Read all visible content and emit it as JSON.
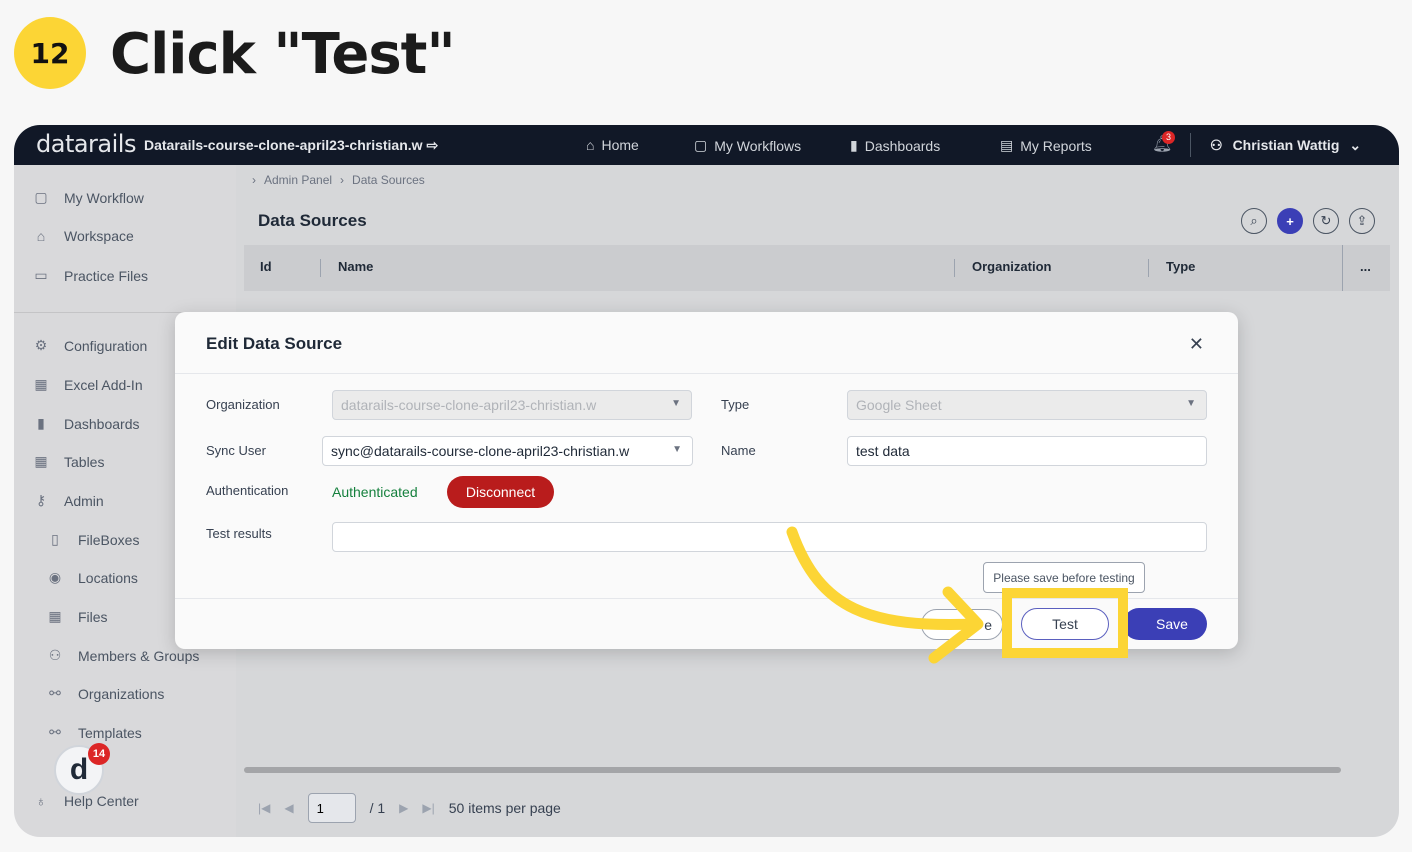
{
  "step": {
    "number": "12",
    "title": "Click \"Test\""
  },
  "topbar": {
    "logo": "datarails",
    "org": "Datarails-course-clone-april23-christian.w",
    "nav": [
      {
        "label": "Home",
        "icon": "home-icon"
      },
      {
        "label": "My Workflows",
        "icon": "clipboard-icon"
      },
      {
        "label": "Dashboards",
        "icon": "bar-chart-icon"
      },
      {
        "label": "My Reports",
        "icon": "document-icon"
      }
    ],
    "notifications": "3",
    "user": "Christian Wattig"
  },
  "sidebar": {
    "top_items": [
      "My Workflow",
      "Workspace",
      "Practice Files"
    ],
    "items": [
      "Configuration",
      "Excel Add-In",
      "Dashboards",
      "Tables",
      "Admin"
    ],
    "admin_items": [
      "FileBoxes",
      "Locations",
      "Files",
      "Members & Groups",
      "Organizations",
      "Templates"
    ],
    "help": "Help Center",
    "helper_badge": "14"
  },
  "main": {
    "breadcrumb": [
      "Admin Panel",
      "Data Sources"
    ],
    "title": "Data Sources",
    "columns": [
      "Id",
      "Name",
      "Organization",
      "Type",
      "..."
    ],
    "pager": {
      "page": "1",
      "total": "/ 1",
      "per_page": "50 items per page"
    }
  },
  "modal": {
    "title": "Edit Data Source",
    "labels": {
      "organization": "Organization",
      "type": "Type",
      "sync_user": "Sync User",
      "name": "Name",
      "authentication": "Authentication",
      "test_results": "Test results"
    },
    "values": {
      "organization": "datarails-course-clone-april23-christian.w",
      "type": "Google Sheet",
      "sync_user": "sync@datarails-course-clone-april23-christian.w",
      "name": "test data",
      "auth_status": "Authenticated",
      "test_results": ""
    },
    "buttons": {
      "disconnect": "Disconnect",
      "ghost": "e",
      "test": "Test",
      "save": "Save"
    },
    "tooltip": "Please save before testing"
  },
  "colors": {
    "highlight": "#fcd535",
    "primary": "#3b3fb6",
    "danger": "#b91c1c",
    "success": "#15803d"
  }
}
